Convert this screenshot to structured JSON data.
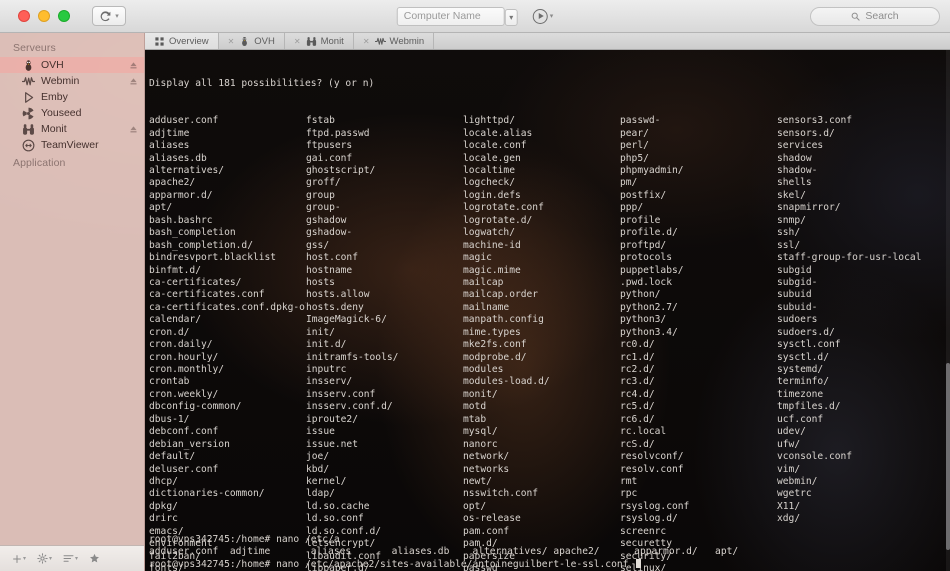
{
  "window": {
    "traffic_lights": [
      "close",
      "minimize",
      "zoom"
    ],
    "connect_label": "",
    "computer_name_placeholder": "Computer Name",
    "search_placeholder": "Search"
  },
  "sidebar": {
    "sections": [
      {
        "title": "Serveurs",
        "items": [
          {
            "label": "OVH",
            "icon": "linux-penguin-icon",
            "selected": true,
            "eject": true
          },
          {
            "label": "Webmin",
            "icon": "webmin-icon",
            "selected": false,
            "eject": true
          },
          {
            "label": "Emby",
            "icon": "play-triangle-icon",
            "selected": false,
            "eject": false
          },
          {
            "label": "Youseed",
            "icon": "radioactive-icon",
            "selected": false,
            "eject": false
          },
          {
            "label": "Monit",
            "icon": "binoculars-icon",
            "selected": false,
            "eject": true
          },
          {
            "label": "TeamViewer",
            "icon": "teamviewer-icon",
            "selected": false,
            "eject": false
          }
        ]
      },
      {
        "title": "Application",
        "items": []
      }
    ],
    "bottom_bar": [
      "add-icon",
      "gear-icon",
      "list-icon",
      "star-icon"
    ]
  },
  "tabs": [
    {
      "label": "Overview",
      "icon": "grid-icon",
      "active": true,
      "closable": false
    },
    {
      "label": "OVH",
      "icon": "linux-penguin-icon",
      "active": false,
      "closable": true
    },
    {
      "label": "Monit",
      "icon": "binoculars-icon",
      "active": false,
      "closable": true
    },
    {
      "label": "Webmin",
      "icon": "webmin-icon",
      "active": false,
      "closable": true
    }
  ],
  "terminal": {
    "prompt_question": "Display all 181 possibilities? (y or n)",
    "columns": [
      [
        "adduser.conf",
        "adjtime",
        "aliases",
        "aliases.db",
        "alternatives/",
        "apache2/",
        "apparmor.d/",
        "apt/",
        "bash.bashrc",
        "bash_completion",
        "bash_completion.d/",
        "bindresvport.blacklist",
        "binfmt.d/",
        "ca-certificates/",
        "ca-certificates.conf",
        "ca-certificates.conf.dpkg-old",
        "calendar/",
        "cron.d/",
        "cron.daily/",
        "cron.hourly/",
        "cron.monthly/",
        "crontab",
        "cron.weekly/",
        "dbconfig-common/",
        "dbus-1/",
        "debconf.conf",
        "debian_version",
        "default/",
        "deluser.conf",
        "dhcp/",
        "dictionaries-common/",
        "dpkg/",
        "drirc",
        "emacs/",
        "environment",
        "fail2ban/",
        "fonts/"
      ],
      [
        "fstab",
        "ftpd.passwd",
        "ftpusers",
        "gai.conf",
        "ghostscript/",
        "groff/",
        "group",
        "group-",
        "gshadow",
        "gshadow-",
        "gss/",
        "host.conf",
        "hostname",
        "hosts",
        "hosts.allow",
        "hosts.deny",
        "ImageMagick-6/",
        "init/",
        "init.d/",
        "initramfs-tools/",
        "inputrc",
        "insserv/",
        "insserv.conf",
        "insserv.conf.d/",
        "iproute2/",
        "issue",
        "issue.net",
        "joe/",
        "kbd/",
        "kernel/",
        "ldap/",
        "ld.so.cache",
        "ld.so.conf",
        "ld.so.conf.d/",
        "letsencrypt/",
        "libaudit.conf",
        "libpaper.d/"
      ],
      [
        "lighttpd/",
        "locale.alias",
        "locale.conf",
        "locale.gen",
        "localtime",
        "logcheck/",
        "login.defs",
        "logrotate.conf",
        "logrotate.d/",
        "logwatch/",
        "machine-id",
        "magic",
        "magic.mime",
        "mailcap",
        "mailcap.order",
        "mailname",
        "manpath.config",
        "mime.types",
        "mke2fs.conf",
        "modprobe.d/",
        "modules",
        "modules-load.d/",
        "monit/",
        "motd",
        "mtab",
        "mysql/",
        "nanorc",
        "network/",
        "networks",
        "newt/",
        "nsswitch.conf",
        "opt/",
        "os-release",
        "pam.conf",
        "pam.d/",
        "papersize",
        "passwd"
      ],
      [
        "passwd-",
        "pear/",
        "perl/",
        "php5/",
        "phpmyadmin/",
        "pm/",
        "postfix/",
        "ppp/",
        "profile",
        "profile.d/",
        "proftpd/",
        "protocols",
        "puppetlabs/",
        ".pwd.lock",
        "python/",
        "python2.7/",
        "python3/",
        "python3.4/",
        "rc0.d/",
        "rc1.d/",
        "rc2.d/",
        "rc3.d/",
        "rc4.d/",
        "rc5.d/",
        "rc6.d/",
        "rc.local",
        "rcS.d/",
        "resolvconf/",
        "resolv.conf",
        "rmt",
        "rpc",
        "rsyslog.conf",
        "rsyslog.d/",
        "screenrc",
        "securetty",
        "security/",
        "selinux/"
      ],
      [
        "sensors3.conf",
        "sensors.d/",
        "services",
        "shadow",
        "shadow-",
        "shells",
        "skel/",
        "snapmirror/",
        "snmp/",
        "ssh/",
        "ssl/",
        "staff-group-for-usr-local",
        "subgid",
        "subgid-",
        "subuid",
        "subuid-",
        "sudoers",
        "sudoers.d/",
        "sysctl.conf",
        "sysctl.d/",
        "systemd/",
        "terminfo/",
        "timezone",
        "tmpfiles.d/",
        "ucf.conf",
        "udev/",
        "ufw/",
        "vconsole.conf",
        "vim/",
        "webmin/",
        "wgetrc",
        "X11/",
        "xdg/"
      ]
    ],
    "footer_lines": [
      "root@vps342745:/home# nano /etc/a",
      "adduser.conf  adjtime       aliases       aliases.db    alternatives/ apache2/      apparmor.d/   apt/",
      "root@vps342745:/home# nano /etc/apache2/sites-available/antoineguilbert-le-ssl.conf "
    ]
  },
  "colors": {
    "sidebar_bg": "#ecced0",
    "sidebar_selected": "#f0aaa5",
    "terminal_fg": "#d9d4cf",
    "terminal_bg": "#0d0a09",
    "titlebar_bg": "#e5e5e5"
  }
}
